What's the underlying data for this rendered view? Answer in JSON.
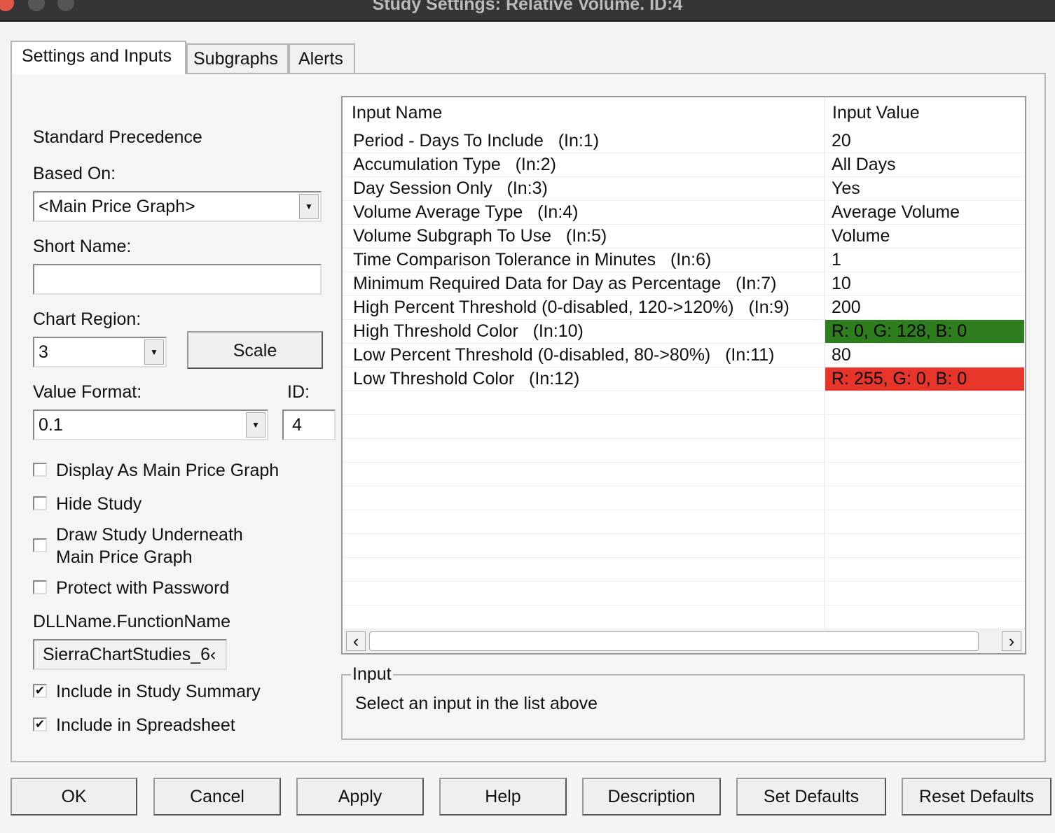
{
  "window": {
    "title": "Study Settings: Relative Volume. ID:4"
  },
  "tabs": [
    {
      "label": "Settings and Inputs"
    },
    {
      "label": "Subgraphs"
    },
    {
      "label": "Alerts"
    }
  ],
  "left": {
    "standard_precedence": "Standard Precedence",
    "based_on_label": "Based On:",
    "based_on_value": "<Main Price Graph>",
    "short_name_label": "Short Name:",
    "short_name_value": "",
    "chart_region_label": "Chart Region:",
    "chart_region_value": "3",
    "scale_button": "Scale",
    "value_format_label": "Value Format:",
    "value_format_value": "0.1",
    "id_label": "ID:",
    "id_value": "4",
    "checkboxes": [
      {
        "label": "Display As Main Price Graph",
        "checked": false
      },
      {
        "label": "Hide Study",
        "checked": false
      },
      {
        "label": "Draw Study Underneath",
        "label2": "Main Price Graph",
        "checked": false
      },
      {
        "label": "Protect with Password",
        "checked": false
      }
    ],
    "dll_label": "DLLName.FunctionName",
    "dll_value": "SierraChartStudies_6‹",
    "checkboxes2": [
      {
        "label": "Include in Study Summary",
        "checked": true
      },
      {
        "label": "Include in Spreadsheet",
        "checked": true
      }
    ],
    "check_mark": "✔"
  },
  "grid": {
    "headers": [
      "Input Name",
      "Input Value"
    ],
    "rows": [
      {
        "name": "Period - Days To Include   (In:1)",
        "value": "20"
      },
      {
        "name": "Accumulation Type   (In:2)",
        "value": "All Days"
      },
      {
        "name": "Day Session Only   (In:3)",
        "value": "Yes"
      },
      {
        "name": "Volume Average Type   (In:4)",
        "value": "Average Volume"
      },
      {
        "name": "Volume Subgraph To Use   (In:5)",
        "value": "Volume"
      },
      {
        "name": "Time Comparison Tolerance in Minutes   (In:6)",
        "value": "1"
      },
      {
        "name": "Minimum Required Data for Day as Percentage   (In:7)",
        "value": "10"
      },
      {
        "name": "High Percent Threshold (0-disabled, 120->120%)   (In:9)",
        "value": "200"
      },
      {
        "name": "High Threshold Color   (In:10)",
        "value": "R: 0, G: 128, B: 0",
        "color": "#2e7d1f"
      },
      {
        "name": "Low Percent Threshold (0-disabled, 80->80%)   (In:11)",
        "value": "80"
      },
      {
        "name": "Low Threshold Color   (In:12)",
        "value": "R: 255, G: 0, B: 0",
        "color": "#e8352a"
      }
    ],
    "scroll_left": "‹",
    "scroll_right": "›"
  },
  "input_group": {
    "title": "Input",
    "text": "Select an input in the list above"
  },
  "buttons": [
    "OK",
    "Cancel",
    "Apply",
    "Help",
    "Description",
    "Set Defaults",
    "Reset Defaults"
  ]
}
